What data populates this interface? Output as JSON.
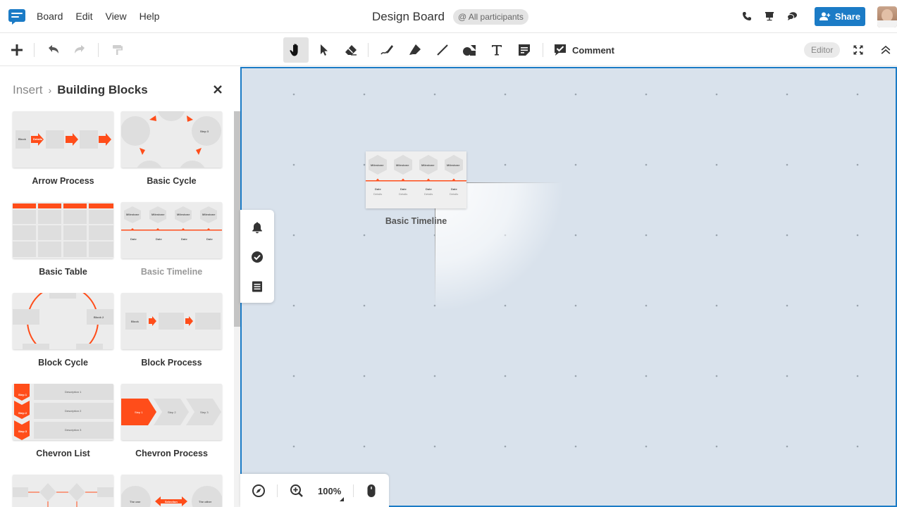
{
  "menu_bar": {
    "items": [
      "Board",
      "Edit",
      "View",
      "Help"
    ],
    "title": "Design Board",
    "participants": "@ All participants",
    "share_label": "Share",
    "icons": [
      "phone-icon",
      "presentation-icon",
      "chat-icon"
    ]
  },
  "toolbar": {
    "comment_label": "Comment",
    "mode_badge": "Editor",
    "tools": [
      "add-icon",
      "undo-icon",
      "redo-icon",
      "format-painter-icon",
      "hand-icon",
      "pointer-icon",
      "eraser-icon",
      "pen-icon",
      "highlighter-icon",
      "line-icon",
      "shapes-icon",
      "text-icon",
      "sticky-note-icon",
      "comment-icon",
      "fullscreen-icon",
      "collapse-icon"
    ]
  },
  "sidebar": {
    "breadcrumb_root": "Insert",
    "breadcrumb_current": "Building Blocks",
    "blocks": [
      {
        "label": "Arrow Process"
      },
      {
        "label": "Basic Cycle"
      },
      {
        "label": "Basic Table"
      },
      {
        "label": "Basic Timeline"
      },
      {
        "label": "Block Cycle"
      },
      {
        "label": "Block Process"
      },
      {
        "label": "Chevron List"
      },
      {
        "label": "Chevron Process"
      }
    ],
    "thumb_text": {
      "block": "Block",
      "details": "Details",
      "step3": "Step 3",
      "milestone": "Milestone",
      "date": "Date",
      "block2": "Block 2",
      "description1": "Description 1",
      "description2": "Description 2",
      "description3": "Description 3",
      "step1": "Step 1",
      "step2": "Step 2",
      "the_one": "The one",
      "the_other": "The other",
      "selection": "Selection"
    }
  },
  "canvas": {
    "placed_block_label": "Basic Timeline",
    "background": "#d9e2ec",
    "accent": "#ff4d1a"
  },
  "zoom": {
    "level": "100%"
  },
  "colors": {
    "brand_blue": "#1b7bc6",
    "accent_orange": "#ff4d1a"
  }
}
